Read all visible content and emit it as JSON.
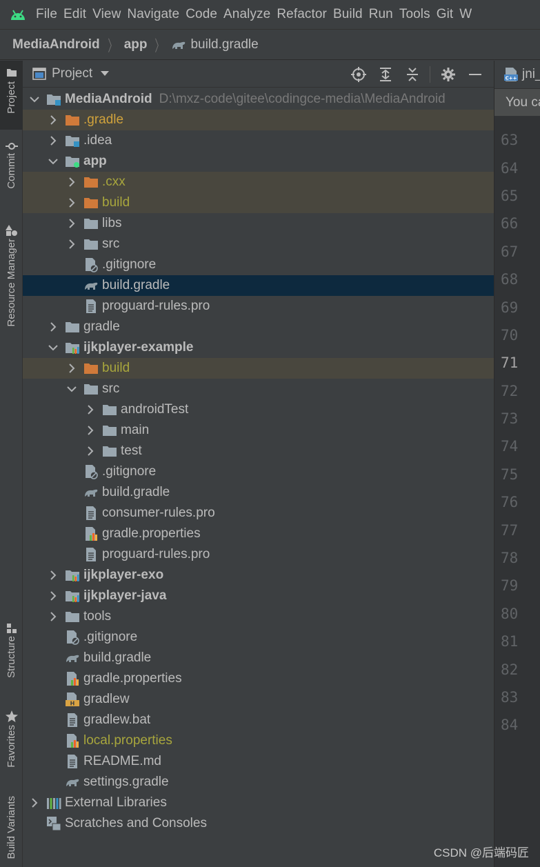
{
  "menubar": {
    "items": [
      "File",
      "Edit",
      "View",
      "Navigate",
      "Code",
      "Analyze",
      "Refactor",
      "Build",
      "Run",
      "Tools",
      "Git",
      "W"
    ]
  },
  "breadcrumb": {
    "project": "MediaAndroid",
    "module": "app",
    "file": "build.gradle"
  },
  "left_stripe": {
    "tabs": [
      "Project",
      "Commit",
      "Resource Manager",
      "Structure",
      "Favorites",
      "Build Variants"
    ]
  },
  "panel": {
    "title": "Project"
  },
  "tree": [
    {
      "label": "MediaAndroid",
      "path": "D:\\mxz-code\\gitee\\codingce-media\\MediaAndroid",
      "depth": 0,
      "arrow": "down",
      "icon": "module-folder-icon",
      "bold": true
    },
    {
      "label": ".gradle",
      "depth": 1,
      "arrow": "right",
      "icon": "excluded-folder-icon",
      "style": "orange",
      "excluded": true
    },
    {
      "label": ".idea",
      "depth": 1,
      "arrow": "right",
      "icon": "idea-folder-icon"
    },
    {
      "label": "app",
      "depth": 1,
      "arrow": "down",
      "icon": "android-module-icon",
      "bold": true
    },
    {
      "label": ".cxx",
      "depth": 2,
      "arrow": "right",
      "icon": "excluded-folder-icon",
      "style": "olive",
      "excluded": true
    },
    {
      "label": "build",
      "depth": 2,
      "arrow": "right",
      "icon": "excluded-folder-icon",
      "style": "olive",
      "excluded": true
    },
    {
      "label": "libs",
      "depth": 2,
      "arrow": "right",
      "icon": "folder-icon"
    },
    {
      "label": "src",
      "depth": 2,
      "arrow": "right",
      "icon": "folder-icon"
    },
    {
      "label": ".gitignore",
      "depth": 2,
      "arrow": "none",
      "icon": "gitignore-icon"
    },
    {
      "label": "build.gradle",
      "depth": 2,
      "arrow": "none",
      "icon": "gradle-icon",
      "selected": true
    },
    {
      "label": "proguard-rules.pro",
      "depth": 2,
      "arrow": "none",
      "icon": "text-file-icon"
    },
    {
      "label": "gradle",
      "depth": 1,
      "arrow": "right",
      "icon": "folder-icon"
    },
    {
      "label": "ijkplayer-example",
      "depth": 1,
      "arrow": "down",
      "icon": "library-module-icon",
      "bold": true
    },
    {
      "label": "build",
      "depth": 2,
      "arrow": "right",
      "icon": "excluded-folder-icon",
      "style": "olive",
      "excluded": true
    },
    {
      "label": "src",
      "depth": 2,
      "arrow": "down",
      "icon": "folder-icon"
    },
    {
      "label": "androidTest",
      "depth": 3,
      "arrow": "right",
      "icon": "folder-icon"
    },
    {
      "label": "main",
      "depth": 3,
      "arrow": "right",
      "icon": "folder-icon"
    },
    {
      "label": "test",
      "depth": 3,
      "arrow": "right",
      "icon": "folder-icon"
    },
    {
      "label": ".gitignore",
      "depth": 2,
      "arrow": "none",
      "icon": "gitignore-icon"
    },
    {
      "label": "build.gradle",
      "depth": 2,
      "arrow": "none",
      "icon": "gradle-icon"
    },
    {
      "label": "consumer-rules.pro",
      "depth": 2,
      "arrow": "none",
      "icon": "text-file-icon"
    },
    {
      "label": "gradle.properties",
      "depth": 2,
      "arrow": "none",
      "icon": "properties-icon"
    },
    {
      "label": "proguard-rules.pro",
      "depth": 2,
      "arrow": "none",
      "icon": "text-file-icon"
    },
    {
      "label": "ijkplayer-exo",
      "depth": 1,
      "arrow": "right",
      "icon": "library-module-icon",
      "bold": true
    },
    {
      "label": "ijkplayer-java",
      "depth": 1,
      "arrow": "right",
      "icon": "library-module-icon",
      "bold": true
    },
    {
      "label": "tools",
      "depth": 1,
      "arrow": "right",
      "icon": "folder-icon"
    },
    {
      "label": ".gitignore",
      "depth": 1,
      "arrow": "none",
      "icon": "gitignore-icon"
    },
    {
      "label": "build.gradle",
      "depth": 1,
      "arrow": "none",
      "icon": "gradle-icon"
    },
    {
      "label": "gradle.properties",
      "depth": 1,
      "arrow": "none",
      "icon": "properties-icon"
    },
    {
      "label": "gradlew",
      "depth": 1,
      "arrow": "none",
      "icon": "shell-script-icon"
    },
    {
      "label": "gradlew.bat",
      "depth": 1,
      "arrow": "none",
      "icon": "text-file-icon"
    },
    {
      "label": "local.properties",
      "depth": 1,
      "arrow": "none",
      "icon": "properties-icon",
      "style": "olive"
    },
    {
      "label": "README.md",
      "depth": 1,
      "arrow": "none",
      "icon": "text-file-icon"
    },
    {
      "label": "settings.gradle",
      "depth": 1,
      "arrow": "none",
      "icon": "gradle-icon"
    },
    {
      "label": "External Libraries",
      "depth": 0,
      "arrow": "right",
      "icon": "libraries-icon"
    },
    {
      "label": "Scratches and Consoles",
      "depth": 0,
      "arrow": "none",
      "icon": "scratches-icon"
    }
  ],
  "editor": {
    "tab_label": "jni_",
    "banner": "You ca",
    "line_numbers": [
      "63",
      "64",
      "65",
      "66",
      "67",
      "68",
      "69",
      "70",
      "71",
      "72",
      "73",
      "74",
      "75",
      "76",
      "77",
      "78",
      "79",
      "80",
      "81",
      "82",
      "83",
      "84"
    ],
    "current_line": "71"
  },
  "watermark": "CSDN @后端码匠"
}
